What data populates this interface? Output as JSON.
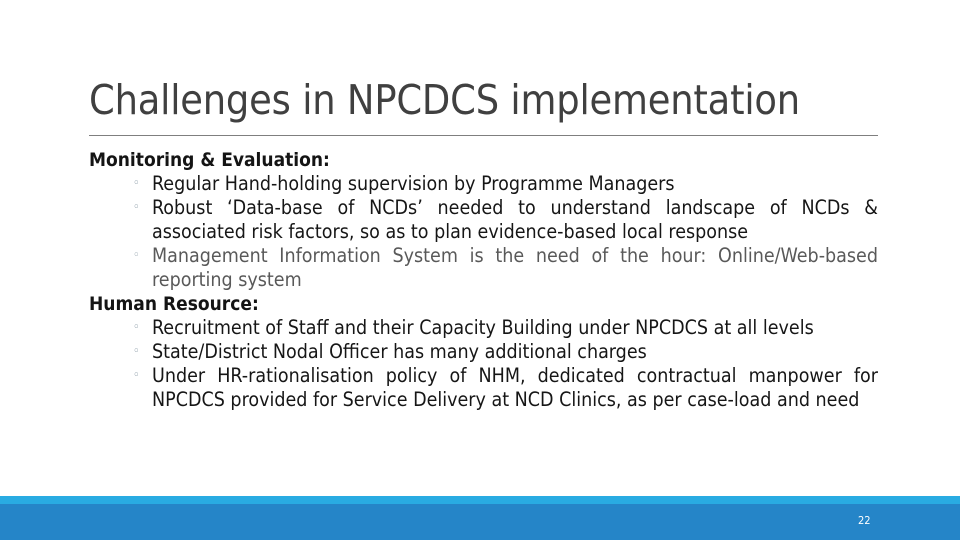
{
  "slide": {
    "title": "Challenges in NPCDCS implementation",
    "page_number": "22",
    "title_color": "#404040",
    "body_color": "#161616",
    "dim_color": "#595959",
    "rule_color": "#7f7f7f",
    "footer_light_color": "#29abe2",
    "footer_dark_color": "#2585c8",
    "bullet_glyph": "◦"
  },
  "sections": [
    {
      "heading": "Monitoring & Evaluation:",
      "bullets": [
        {
          "text": "Regular Hand-holding supervision by Programme Managers",
          "justified": false,
          "dim": false
        },
        {
          "text": "Robust ‘Data-base of NCDs’ needed to understand landscape of NCDs & associated risk factors, so as to plan evidence-based local response",
          "justified": true,
          "dim": false
        },
        {
          "text": "Management Information System is the need of the hour: Online/Web-based reporting system",
          "justified": true,
          "dim": true
        }
      ]
    },
    {
      "heading": "Human Resource:",
      "bullets": [
        {
          "text": "Recruitment of Staff and their Capacity Building under NPCDCS at all levels",
          "justified": false,
          "dim": false
        },
        {
          "text": "State/District Nodal Officer has many additional charges",
          "justified": false,
          "dim": false
        },
        {
          "text": "Under HR-rationalisation policy of NHM, dedicated contractual manpower for NPCDCS provided for Service Delivery at NCD Clinics, as per case-load and need",
          "justified": true,
          "dim": false
        }
      ]
    }
  ]
}
